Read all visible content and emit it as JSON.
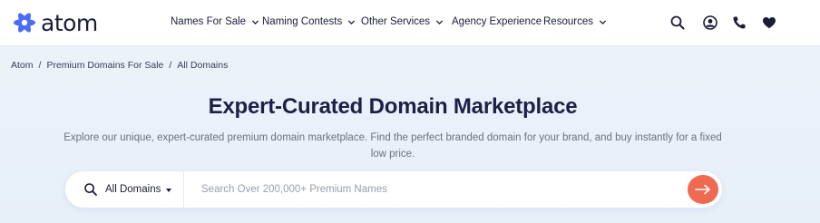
{
  "colors": {
    "brand_dark": "#1c1c3a",
    "logo_blue": "#4a6cf7",
    "accent_orange": "#ef6a50",
    "background": "#eef3fb"
  },
  "header": {
    "logo_text": "atom",
    "nav": [
      {
        "label": "Names For Sale",
        "has_dropdown": true
      },
      {
        "label": "Naming Contests",
        "has_dropdown": true
      },
      {
        "label": "Other Services",
        "has_dropdown": true
      },
      {
        "label": "Agency Experience",
        "has_dropdown": false
      },
      {
        "label": "Resources",
        "has_dropdown": true
      }
    ],
    "icons": [
      "search-icon",
      "user-icon",
      "phone-icon",
      "heart-icon"
    ]
  },
  "breadcrumb": {
    "items": [
      "Atom",
      "Premium Domains For Sale",
      "All Domains"
    ],
    "separator": "/"
  },
  "hero": {
    "title": "Expert-Curated Domain Marketplace",
    "subtitle": "Explore our unique, expert-curated premium domain marketplace. Find the perfect branded domain for your brand, and buy instantly for a fixed low price."
  },
  "search": {
    "filter_value": "All Domains",
    "placeholder": "Search Over 200,000+ Premium Names",
    "value": ""
  }
}
